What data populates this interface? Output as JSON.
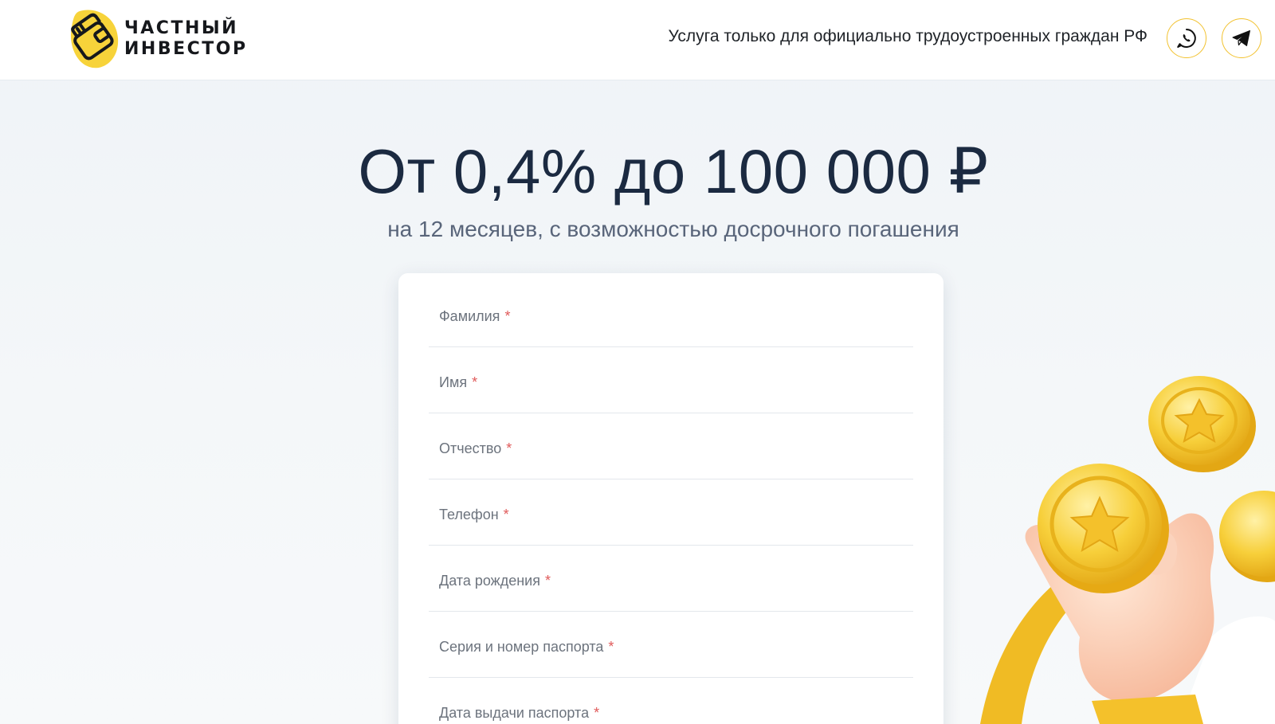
{
  "header": {
    "logo_line1": "ЧАСТНЫЙ",
    "logo_line2": "ИНВЕСТОР",
    "tagline": "Услуга только для официально трудоустроенных граждан РФ",
    "accent_color": "#f2c230"
  },
  "hero": {
    "title": "От 0,4% до 100 000 ₽",
    "subtitle": "на 12 месяцев, с возможностью досрочного погашения"
  },
  "form": {
    "required_mark": "*",
    "fields": [
      {
        "label": "Фамилия"
      },
      {
        "label": "Имя"
      },
      {
        "label": "Отчество"
      },
      {
        "label": "Телефон"
      },
      {
        "label": "Дата рождения"
      },
      {
        "label": "Серия и номер паспорта"
      },
      {
        "label": "Дата выдачи паспорта"
      }
    ]
  },
  "icons": {
    "whatsapp": "whatsapp-icon",
    "telegram": "telegram-icon"
  }
}
